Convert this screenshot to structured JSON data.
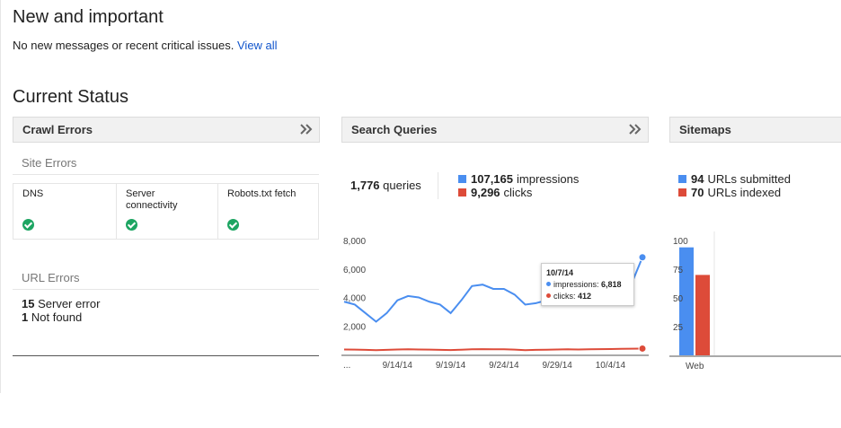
{
  "new_important": {
    "title": "New and important",
    "message": "No new messages or recent critical issues.",
    "view_all": "View all"
  },
  "current_status": {
    "title": "Current Status"
  },
  "crawl_errors": {
    "title": "Crawl Errors",
    "site_errors_label": "Site Errors",
    "site_errors": [
      {
        "label": "DNS",
        "status": "ok"
      },
      {
        "label": "Server connectivity",
        "status": "ok"
      },
      {
        "label": "Robots.txt fetch",
        "status": "ok"
      }
    ],
    "url_errors_label": "URL Errors",
    "url_errors": [
      {
        "count": "15",
        "label": "Server error"
      },
      {
        "count": "1",
        "label": "Not found"
      }
    ]
  },
  "search_queries": {
    "title": "Search Queries",
    "queries_count": "1,776",
    "queries_label": "queries",
    "impressions_count": "107,165",
    "impressions_label": "impressions",
    "clicks_count": "9,296",
    "clicks_label": "clicks",
    "tooltip": {
      "date": "10/7/14",
      "impressions_label": "impressions:",
      "impressions_value": "6,818",
      "clicks_label": "clicks:",
      "clicks_value": "412"
    }
  },
  "sitemaps": {
    "title": "Sitemaps",
    "submitted_count": "94",
    "submitted_label": "URLs submitted",
    "indexed_count": "70",
    "indexed_label": "URLs indexed"
  },
  "colors": {
    "impressions": "#4a8ef0",
    "clicks": "#dd4b39",
    "ok": "#1da562",
    "link": "#1155cc"
  },
  "chart_data": [
    {
      "type": "line",
      "x": [
        "9/9/14",
        "9/10/14",
        "9/11/14",
        "9/12/14",
        "9/13/14",
        "9/14/14",
        "9/15/14",
        "9/16/14",
        "9/17/14",
        "9/18/14",
        "9/19/14",
        "9/20/14",
        "9/21/14",
        "9/22/14",
        "9/23/14",
        "9/24/14",
        "9/25/14",
        "9/26/14",
        "9/27/14",
        "9/28/14",
        "9/29/14",
        "9/30/14",
        "10/1/14",
        "10/2/14",
        "10/3/14",
        "10/4/14",
        "10/5/14",
        "10/6/14",
        "10/7/14"
      ],
      "series": [
        {
          "name": "impressions",
          "values": [
            3700,
            3500,
            2900,
            2300,
            2900,
            3800,
            4100,
            4000,
            3700,
            3500,
            2900,
            3800,
            4800,
            4900,
            4600,
            4600,
            4200,
            3500,
            3600,
            3800,
            4000,
            4100,
            4000,
            4100,
            4200,
            4400,
            4500,
            5000,
            6818
          ]
        },
        {
          "name": "clicks",
          "values": [
            350,
            340,
            320,
            300,
            320,
            350,
            360,
            350,
            340,
            320,
            310,
            330,
            360,
            370,
            360,
            360,
            340,
            300,
            320,
            330,
            350,
            360,
            350,
            360,
            370,
            380,
            390,
            400,
            412
          ]
        }
      ],
      "ylim": [
        0,
        8000
      ],
      "yticks": [
        "8,000",
        "6,000",
        "4,000",
        "2,000"
      ],
      "xticks": [
        "...",
        "9/14/14",
        "9/19/14",
        "9/24/14",
        "9/29/14",
        "10/4/14"
      ],
      "grid": false,
      "xlabel": "",
      "ylabel": ""
    },
    {
      "type": "bar",
      "categories": [
        "Web"
      ],
      "series": [
        {
          "name": "URLs submitted",
          "values": [
            94
          ]
        },
        {
          "name": "URLs indexed",
          "values": [
            70
          ]
        }
      ],
      "ylim": [
        0,
        100
      ],
      "yticks": [
        "100",
        "75",
        "50",
        "25"
      ],
      "xlabel": "",
      "ylabel": ""
    }
  ]
}
